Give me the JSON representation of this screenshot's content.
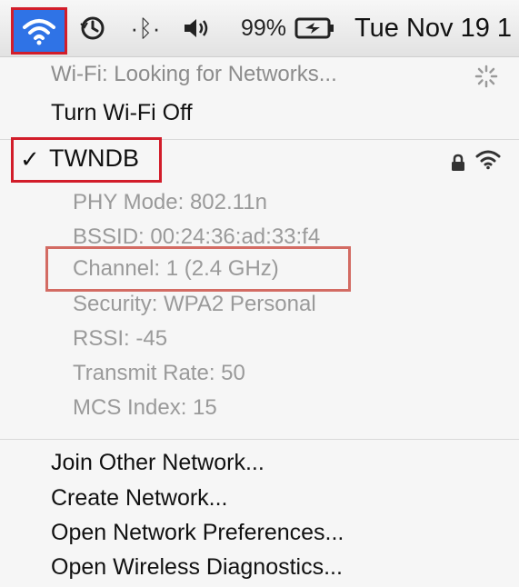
{
  "menubar": {
    "icons": [
      "wifi-icon",
      "time-machine-icon",
      "bluetooth-icon",
      "volume-icon",
      "battery-icon"
    ],
    "battery_percent": "99%",
    "clock": "Tue Nov 19 1"
  },
  "wifi_menu": {
    "status": "Wi-Fi: Looking for Networks...",
    "toggle": "Turn Wi-Fi Off",
    "current_network": {
      "checkmark": "✓",
      "name": "TWNDB",
      "details": [
        "PHY Mode: 802.11n",
        "BSSID: 00:24:36:ad:33:f4",
        "Channel: 1  (2.4 GHz)",
        "Security: WPA2 Personal",
        "RSSI: -45",
        "Transmit Rate: 50",
        "MCS Index: 15"
      ]
    },
    "actions": [
      "Join Other Network...",
      "Create Network...",
      "Open Network Preferences...",
      "Open Wireless Diagnostics..."
    ]
  },
  "colors": {
    "highlight_red": "#d21d2a",
    "menubar_selected_blue": "#2f73e6"
  }
}
